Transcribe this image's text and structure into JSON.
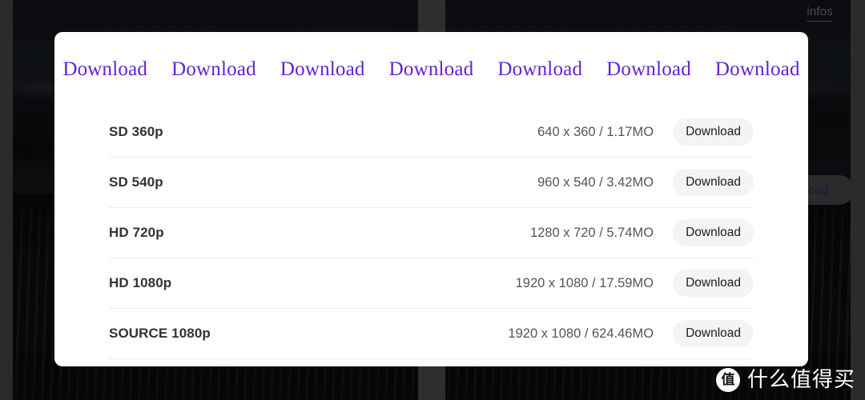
{
  "background": {
    "infos_label": "infos",
    "hidden_pill_label": "Download",
    "watermark": {
      "badge_glyph": "值",
      "text": "什么值得买"
    }
  },
  "modal": {
    "header_links": [
      {
        "label": "Download"
      },
      {
        "label": "Download"
      },
      {
        "label": "Download"
      },
      {
        "label": "Download"
      },
      {
        "label": "Download"
      },
      {
        "label": "Download"
      },
      {
        "label": "Download"
      }
    ],
    "link_color": "#6322d6",
    "rows": [
      {
        "quality": "SD 360p",
        "meta": "640 x 360 / 1.17MO",
        "button": "Download"
      },
      {
        "quality": "SD 540p",
        "meta": "960 x 540 / 3.42MO",
        "button": "Download"
      },
      {
        "quality": "HD 720p",
        "meta": "1280 x 720 / 5.74MO",
        "button": "Download"
      },
      {
        "quality": "HD 1080p",
        "meta": "1920 x 1080 / 17.59MO",
        "button": "Download"
      },
      {
        "quality": "SOURCE 1080p",
        "meta": "1920 x 1080 / 624.46MO",
        "button": "Download"
      }
    ]
  }
}
